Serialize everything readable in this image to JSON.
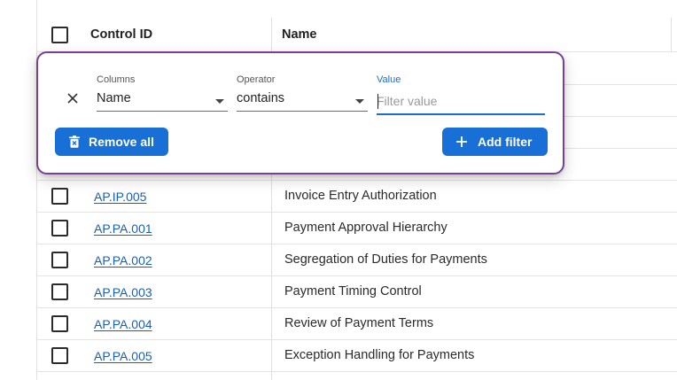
{
  "table": {
    "headers": {
      "control_id": "Control ID",
      "name": "Name"
    },
    "rows": [
      {
        "id": "AP.IP.005",
        "name": "Invoice Entry Authorization"
      },
      {
        "id": "AP.PA.001",
        "name": "Payment Approval Hierarchy"
      },
      {
        "id": "AP.PA.002",
        "name": "Segregation of Duties for Payments"
      },
      {
        "id": "AP.PA.003",
        "name": "Payment Timing Control"
      },
      {
        "id": "AP.PA.004",
        "name": "Review of Payment Terms"
      },
      {
        "id": "AP.PA.005",
        "name": "Exception Handling for Payments"
      }
    ]
  },
  "filter": {
    "columns_label": "Columns",
    "columns_value": "Name",
    "operator_label": "Operator",
    "operator_value": "contains",
    "value_label": "Value",
    "value_placeholder": "Filter value",
    "remove_all_label": "Remove all",
    "add_filter_label": "Add filter"
  },
  "colors": {
    "accent": "#1870d6",
    "popup_border": "#7b3f92",
    "link": "#1a5fb4"
  }
}
